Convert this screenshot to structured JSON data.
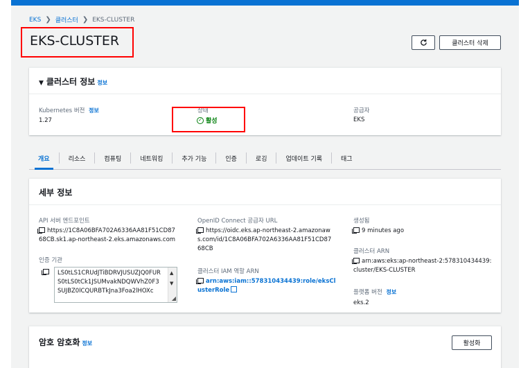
{
  "breadcrumb": {
    "items": [
      "EKS",
      "클러스터"
    ],
    "current": "EKS-CLUSTER",
    "separator": "❯"
  },
  "page": {
    "title": "EKS-CLUSTER",
    "refresh_icon": "refresh-icon",
    "delete_label": "클러스터 삭제"
  },
  "cluster_info": {
    "title": "클러스터 정보",
    "info": "정보",
    "k8s_version_label": "Kubernetes 버전",
    "k8s_version_info": "정보",
    "k8s_version_value": "1.27",
    "status_label": "상태",
    "status_value": "활성",
    "provider_label": "공급자",
    "provider_value": "EKS"
  },
  "tabs": [
    "개요",
    "리소스",
    "컴퓨팅",
    "네트워킹",
    "추가 기능",
    "인증",
    "로깅",
    "업데이트 기록",
    "태그"
  ],
  "details": {
    "title": "세부 정보",
    "api_label": "API 서버 엔드포인트",
    "api_value": "https://1C8A06BFA702A6336AA81F51CD8768CB.sk1.ap-northeast-2.eks.amazonaws.com",
    "cert_label": "인증 기관",
    "cert_value": "LS0tLS1CRUdJTiBDRVJUSUZJQ0FURS0tLS0tCk1JSUMvakNDQWVhZ0F3SUJBZ0lCQURBTkJna3Foa2lHOXc",
    "oidc_label": "OpenID Connect 공급자 URL",
    "oidc_value": "https://oidc.eks.ap-northeast-2.amazonaws.com/id/1C8A06BFA702A6336AA81F51CD8768CB",
    "role_label": "클러스터 IAM 역할 ARN",
    "role_value": "arn:aws:iam::578310434439:role/eksClusterRole",
    "created_label": "생성됨",
    "created_value": "9 minutes ago",
    "arn_label": "클러스터 ARN",
    "arn_value": "arn:aws:eks:ap-northeast-2:578310434439:cluster/EKS-CLUSTER",
    "platform_label": "플랫폼 버전",
    "platform_info": "정보",
    "platform_value": "eks.2"
  },
  "encryption": {
    "title": "암호 암호화",
    "info": "정보",
    "activate_label": "활성화"
  },
  "colors": {
    "accent": "#0972d3",
    "success": "#037f0c",
    "highlight": "#ff0000"
  }
}
